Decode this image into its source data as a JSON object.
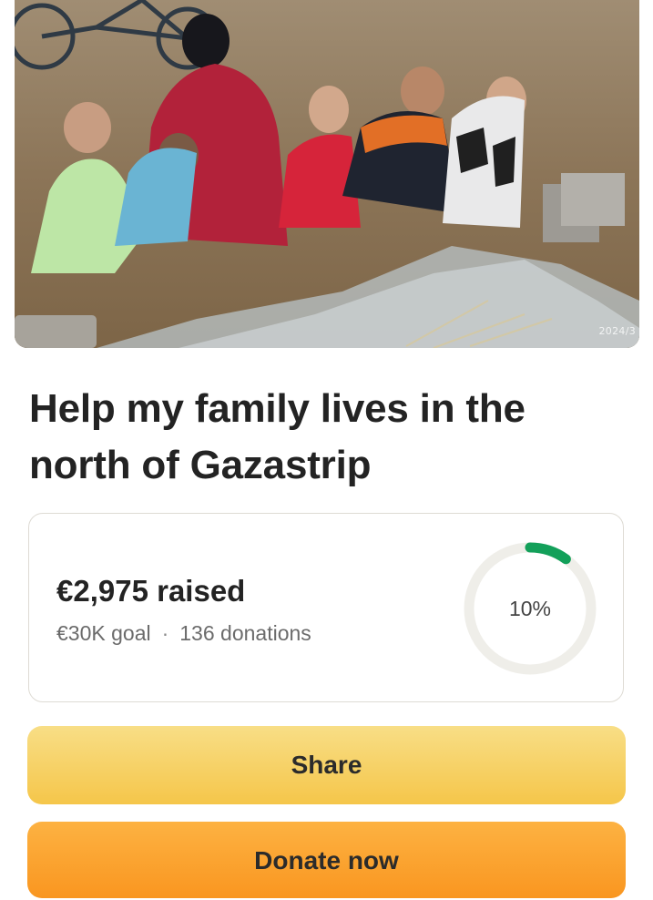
{
  "campaign": {
    "title": "Help my family lives in the north of Gazastrip",
    "photo": {
      "date_stamp": "2024/3"
    }
  },
  "progress": {
    "raised_amount": "€2,975",
    "raised_label": "raised",
    "goal": "€30K goal",
    "separator": "·",
    "donations": "136 donations",
    "percent_label": "10%",
    "percent_value": 0.1,
    "colors": {
      "ring_track": "#efeee9",
      "ring_fill": "#13a05a"
    }
  },
  "actions": {
    "share_label": "Share",
    "donate_label": "Donate now"
  },
  "colors": {
    "share_button": "#f6cf5e",
    "donate_button": "#fba32f"
  }
}
